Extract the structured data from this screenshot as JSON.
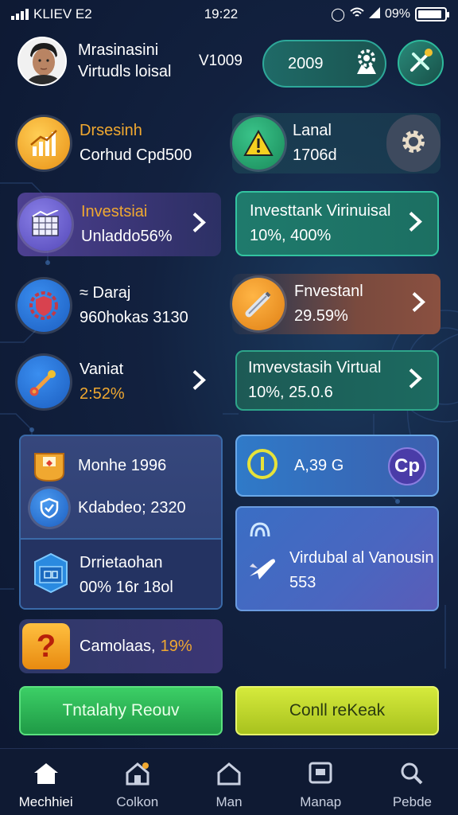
{
  "status_bar": {
    "carrier": "KLIEV E2",
    "time": "19:22",
    "battery": "09%",
    "battery_level": 0.9
  },
  "header": {
    "name_line1": "Mrasinasini",
    "name_line2": "Virtudls loisal",
    "value": "V1009",
    "pill_value": "2009",
    "pill_icon": "gear-people-icon",
    "action_icon": "tools-icon"
  },
  "cards": {
    "c1": {
      "title": "Drsesinh",
      "subtitle": "Corhud Cpd500",
      "icon": "chart-up-icon",
      "title_color": "#f0a830"
    },
    "c2": {
      "title": "Investsiai",
      "subtitle": "Unladdo56%",
      "icon": "bar-chart-icon",
      "title_color": "#f0a830"
    },
    "c3": {
      "title": "≈ Daraj",
      "subtitle": "960hokas 3130",
      "icon": "shield-icon"
    },
    "c4": {
      "title": "Vaniat",
      "subtitle": "2:52%",
      "icon": "wrench-icon",
      "subtitle_color": "#f0a830"
    },
    "c5": {
      "title": "Lanal",
      "subtitle": "1706d",
      "icon": "warning-icon",
      "action_icon": "gear-icon"
    },
    "c6": {
      "title": "Investtank Virinuisal",
      "subtitle": "10%, 400%"
    },
    "c7": {
      "title": "Fnvestanl",
      "subtitle": "29.59%",
      "icon": "tube-icon"
    },
    "c8": {
      "title": "Imvevstasih Virtual",
      "subtitle": "10%, 25.0.6"
    }
  },
  "panel": {
    "row1": "Monhe 1996",
    "row2": "Kdabdeo; 2320",
    "sub_title": "Drrietaohan",
    "sub_value": "00% 16r 18ol"
  },
  "right_small": {
    "value": "A,39 G",
    "badge": "Cp"
  },
  "right_big": {
    "title": "Virdubal al Vanousin",
    "value": "553"
  },
  "help_card": {
    "label": "Camolaas,",
    "percent": "19%"
  },
  "buttons": {
    "left": "Tntalahy Reouv",
    "right": "Conll reKeak"
  },
  "nav": [
    "Mechhiei",
    "Colkon",
    "Man",
    "Manap",
    "Pebde"
  ]
}
